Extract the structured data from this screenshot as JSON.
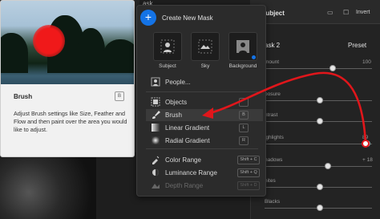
{
  "tooltip": {
    "title": "Brush",
    "key": "B",
    "description": "Adjust Brush settings like Size, Feather and Flow and then paint over the area you would like to adjust."
  },
  "menu": {
    "create_label": "Create New Mask",
    "create_icon": "plus-icon",
    "header_partial": "ask",
    "tiles": [
      {
        "label": "Subject",
        "icon": "subject-icon"
      },
      {
        "label": "Sky",
        "icon": "sky-icon"
      },
      {
        "label": "Background",
        "icon": "background-icon"
      }
    ],
    "people_label": "People...",
    "items": [
      {
        "label": "Objects",
        "key": "",
        "icon": "objects-icon",
        "state": "normal"
      },
      {
        "label": "Brush",
        "key": "B",
        "icon": "brush-icon",
        "state": "active"
      },
      {
        "label": "Linear Gradient",
        "key": "L",
        "icon": "linear-gradient-icon",
        "state": "normal"
      },
      {
        "label": "Radial Gradient",
        "key": "R",
        "icon": "radial-gradient-icon",
        "state": "normal"
      },
      {
        "label": "Color Range",
        "key": "Shift + C",
        "icon": "color-range-icon",
        "state": "normal"
      },
      {
        "label": "Luminance Range",
        "key": "Shift + Q",
        "icon": "luminance-range-icon",
        "state": "normal"
      },
      {
        "label": "Depth Range",
        "key": "Shift + D",
        "icon": "depth-range-icon",
        "state": "disabled"
      }
    ]
  },
  "right_panel": {
    "title": "Subject",
    "invert_label": "Invert",
    "mask_name": "ask 2",
    "preset_label": "Preset",
    "rows": [
      {
        "label": "mount",
        "value": "100",
        "level": 0.62
      },
      {
        "label": "posure",
        "value": "",
        "level": 0.5
      },
      {
        "label": "ntrast",
        "value": "",
        "level": 0.5
      },
      {
        "label": "ighlights",
        "value": "89",
        "level": 0.95
      },
      {
        "label": "hadows",
        "value": "+ 18",
        "level": 0.58
      },
      {
        "label": "hites",
        "value": "",
        "level": 0.5
      },
      {
        "label": "Blacks",
        "value": "",
        "level": 0.5
      }
    ]
  },
  "colors": {
    "accent": "#1473e6",
    "annotation": "#e0161b"
  }
}
